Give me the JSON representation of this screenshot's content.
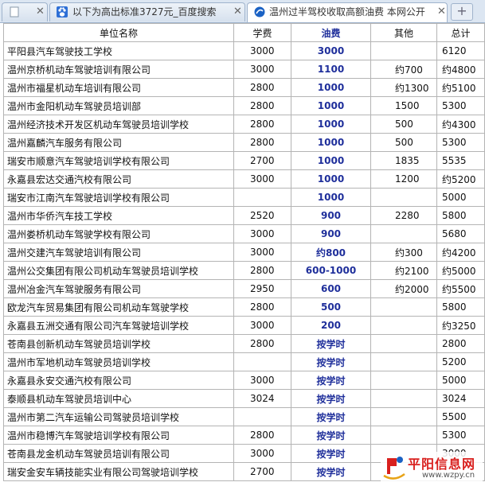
{
  "tabs": [
    {
      "label": "",
      "active": false,
      "icon": "page-icon",
      "close": "✕"
    },
    {
      "label": "以下为高出标准3727元_百度搜索",
      "active": false,
      "icon": "baidu-paw-icon",
      "close": "✕"
    },
    {
      "label": "温州过半驾校收取高额油费  本网公开",
      "active": true,
      "icon": "site-icon",
      "close": "✕"
    }
  ],
  "new_tab_label": "+",
  "table": {
    "headers": {
      "unit": "单位名称",
      "tuition": "学费",
      "fuel": "油费",
      "other": "其他",
      "total": "总计"
    },
    "rows": [
      {
        "unit": "平阳县汽车驾驶技工学校",
        "tuition": "3000",
        "fuel": "3000",
        "other": "",
        "total": "6120"
      },
      {
        "unit": "温州京桥机动车驾驶培训有限公司",
        "tuition": "3000",
        "fuel": "1100",
        "other": "约700",
        "total": "约4800"
      },
      {
        "unit": "温州市福星机动车培训有限公司",
        "tuition": "2800",
        "fuel": "1000",
        "other": "约1300",
        "total": "约5100"
      },
      {
        "unit": "温州市金阳机动车驾驶员培训部",
        "tuition": "2800",
        "fuel": "1000",
        "other": "1500",
        "total": "5300"
      },
      {
        "unit": "温州经济技术开发区机动车驾驶员培训学校",
        "tuition": "2800",
        "fuel": "1000",
        "other": "500",
        "total": "约4300"
      },
      {
        "unit": "温州嘉麟汽车服务有限公司",
        "tuition": "2800",
        "fuel": "1000",
        "other": "500",
        "total": "5300"
      },
      {
        "unit": "瑞安市顺意汽车驾驶培训学校有限公司",
        "tuition": "2700",
        "fuel": "1000",
        "other": "1835",
        "total": "5535"
      },
      {
        "unit": "永嘉县宏达交通汽校有限公司",
        "tuition": "3000",
        "fuel": "1000",
        "other": "1200",
        "total": "约5200"
      },
      {
        "unit": "瑞安市江南汽车驾驶培训学校有限公司",
        "tuition": "",
        "fuel": "1000",
        "other": "",
        "total": "5000"
      },
      {
        "unit": "温州市华侨汽车技工学校",
        "tuition": "2520",
        "fuel": "900",
        "other": "2280",
        "total": "5800"
      },
      {
        "unit": "温州娄桥机动车驾驶学校有限公司",
        "tuition": "3000",
        "fuel": "900",
        "other": "",
        "total": "5680"
      },
      {
        "unit": "温州交建汽车驾驶培训有限公司",
        "tuition": "3000",
        "fuel": "约800",
        "other": "约300",
        "total": "约4200"
      },
      {
        "unit": "温州公交集团有限公司机动车驾驶员培训学校",
        "tuition": "2800",
        "fuel": "600-1000",
        "other": "约2100",
        "total": "约5000"
      },
      {
        "unit": "温州冶金汽车驾驶服务有限公司",
        "tuition": "2950",
        "fuel": "600",
        "other": "约2000",
        "total": "约5500"
      },
      {
        "unit": "欧龙汽车贸易集团有限公司机动车驾驶学校",
        "tuition": "2800",
        "fuel": "500",
        "other": "",
        "total": "5800"
      },
      {
        "unit": "永嘉县五洲交通有限公司汽车驾驶培训学校",
        "tuition": "3000",
        "fuel": "200",
        "other": "",
        "total": "约3250"
      },
      {
        "unit": "苍南县创新机动车驾驶员培训学校",
        "tuition": "2800",
        "fuel": "按学时",
        "other": "",
        "total": "2800"
      },
      {
        "unit": "温州市军地机动车驾驶员培训学校",
        "tuition": "",
        "fuel": "按学时",
        "other": "",
        "total": "5200"
      },
      {
        "unit": "永嘉县永安交通汽校有限公司",
        "tuition": "3000",
        "fuel": "按学时",
        "other": "",
        "total": "5000"
      },
      {
        "unit": "泰顺县机动车驾驶员培训中心",
        "tuition": "3024",
        "fuel": "按学时",
        "other": "",
        "total": "3024"
      },
      {
        "unit": "温州市第二汽车运输公司驾驶员培训学校",
        "tuition": "",
        "fuel": "按学时",
        "other": "",
        "total": "5500"
      },
      {
        "unit": "温州市稳博汽车驾驶培训学校有限公司",
        "tuition": "2800",
        "fuel": "按学时",
        "other": "",
        "total": "5300"
      },
      {
        "unit": "苍南县龙金机动车驾驶员培训有限公司",
        "tuition": "3000",
        "fuel": "按学时",
        "other": "",
        "total": "3000"
      },
      {
        "unit": "瑞安金安车辆技能实业有限公司驾驶培训学校",
        "tuition": "2700",
        "fuel": "按学时",
        "other": "",
        "total": ""
      }
    ]
  },
  "watermark": {
    "title": "平阳信息网",
    "url": "www.wzpy.cn",
    "logo_icon": "site-logo-icon"
  },
  "colors": {
    "fuel_text": "#1f2f9b",
    "tab_bar": "#dce6f2",
    "watermark_red": "#d9201e"
  }
}
